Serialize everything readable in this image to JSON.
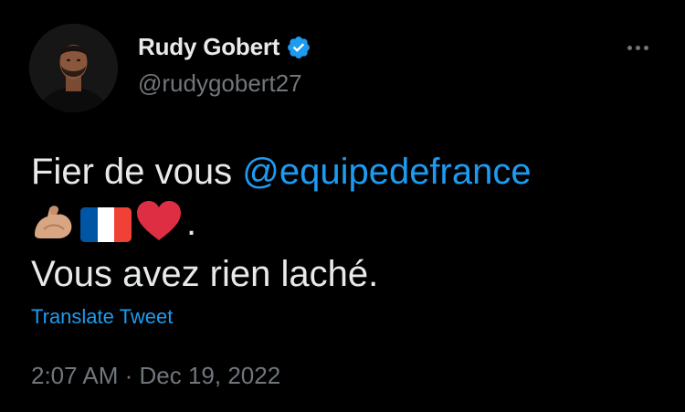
{
  "author": {
    "name": "Rudy Gobert",
    "handle": "@rudygobert27",
    "verified": true,
    "avatar_icon": "profile-photo"
  },
  "tweet": {
    "text_before_mention": "Fier de vous ",
    "mention": "@equipedefrance",
    "emojis": [
      "flexed-biceps",
      "flag-france",
      "red-heart"
    ],
    "emoji_suffix": ".",
    "line_3": "Vous avez rien laché."
  },
  "translate_label": "Translate Tweet",
  "timestamp": {
    "time": "2:07 AM",
    "separator": " · ",
    "date": "Dec 19, 2022"
  },
  "colors": {
    "background": "#000000",
    "text": "#e7e9ea",
    "muted": "#71767b",
    "accent": "#1d9bf0"
  },
  "icons": {
    "more": "more-options-icon",
    "verified": "verified-badge-icon"
  }
}
